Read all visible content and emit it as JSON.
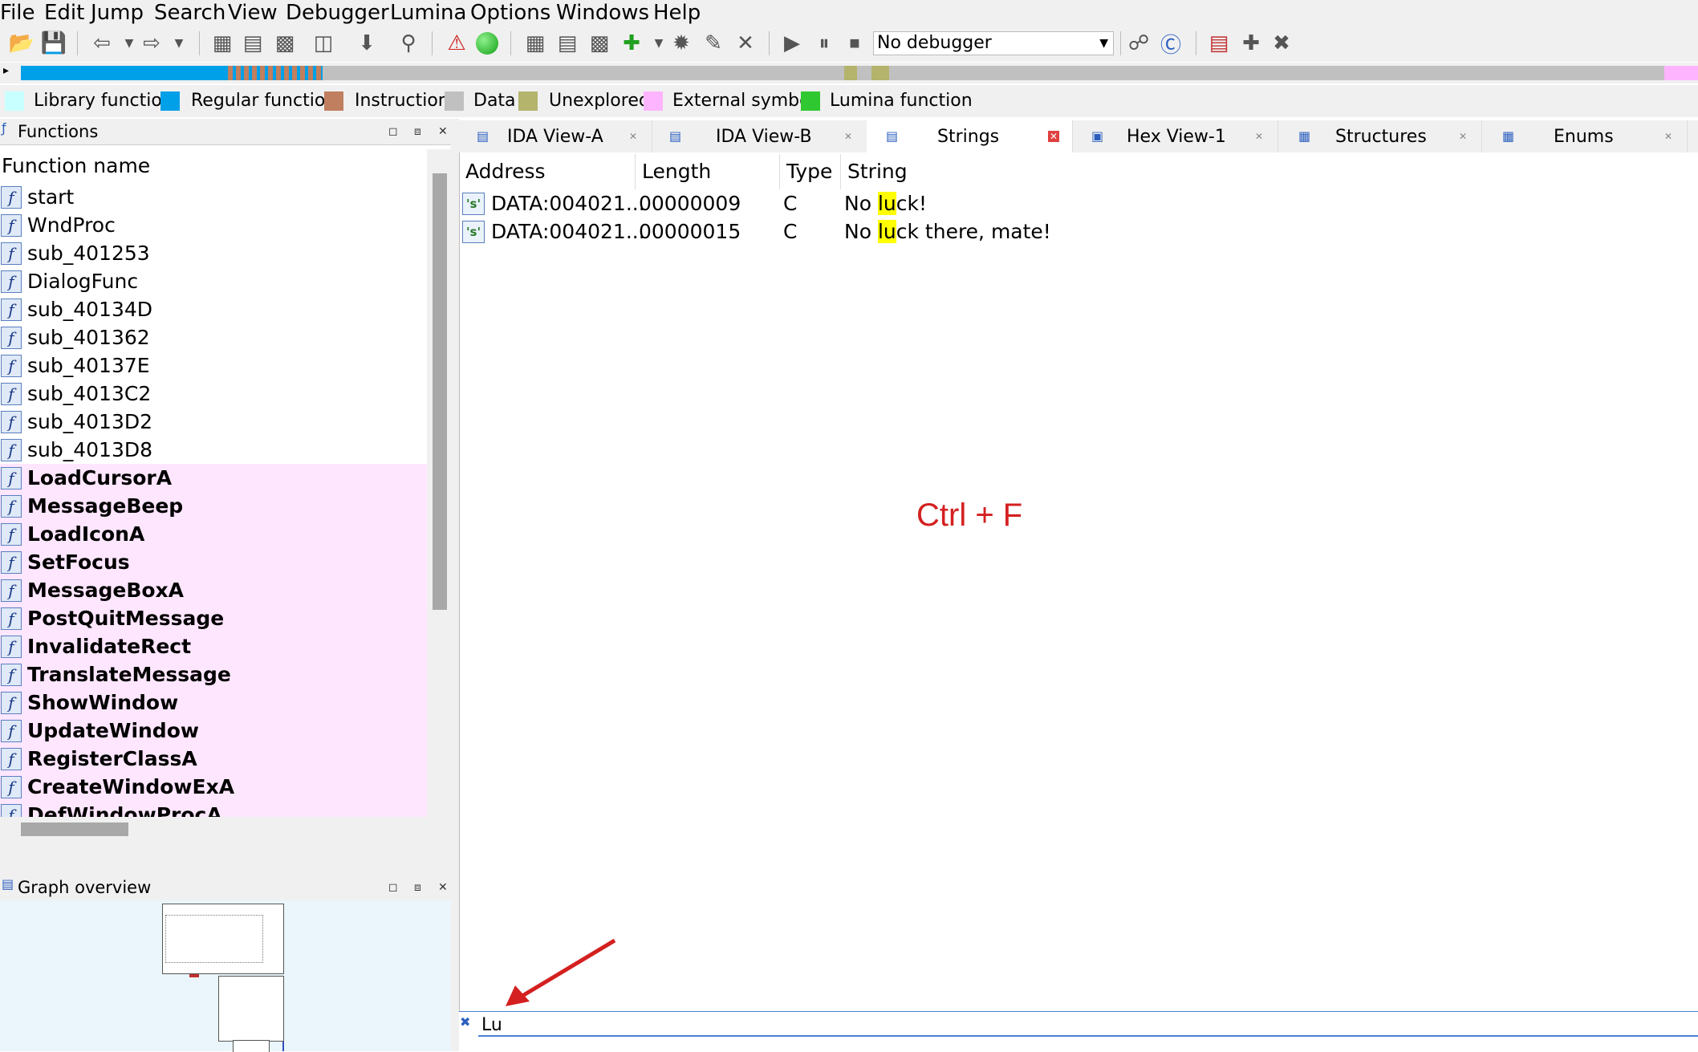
{
  "menu": [
    "File",
    "Edit",
    "Jump",
    "Search",
    "View",
    "Debugger",
    "Lumina",
    "Options",
    "Windows",
    "Help"
  ],
  "toolbar": {
    "debugger_select": "No debugger",
    "icons": [
      "open-icon",
      "save-icon",
      "back-icon",
      "forward-icon",
      "binary-search-icon",
      "text-search-icon",
      "imm-search-icon",
      "search-next-icon",
      "jump-down-icon",
      "find-icon",
      "warning-icon",
      "run-icon",
      "code-icon",
      "data-icon",
      "ascii-icon",
      "string-icon",
      "undefine-icon",
      "patch-icon",
      "cancel-icon",
      "debug-run-icon",
      "debug-pause-icon",
      "debug-stop-icon",
      "c-icon",
      "decompile-icon",
      "struct-icon",
      "add-icon",
      "remove-icon"
    ]
  },
  "legend": [
    {
      "label": "Library function",
      "color": "#c8ffff"
    },
    {
      "label": "Regular function",
      "color": "#00a0e8"
    },
    {
      "label": "Instruction",
      "color": "#c07f5e"
    },
    {
      "label": "Data",
      "color": "#c0c0c0"
    },
    {
      "label": "Unexplored",
      "color": "#b4b46c"
    },
    {
      "label": "External symbol",
      "color": "#ffb4ff"
    },
    {
      "label": "Lumina function",
      "color": "#30c830"
    }
  ],
  "functions_panel": {
    "title": "Functions",
    "column_header": "Function name",
    "items": [
      {
        "name": "start",
        "external": false
      },
      {
        "name": "WndProc",
        "external": false
      },
      {
        "name": "sub_401253",
        "external": false
      },
      {
        "name": "DialogFunc",
        "external": false
      },
      {
        "name": "sub_40134D",
        "external": false
      },
      {
        "name": "sub_401362",
        "external": false
      },
      {
        "name": "sub_40137E",
        "external": false
      },
      {
        "name": "sub_4013C2",
        "external": false
      },
      {
        "name": "sub_4013D2",
        "external": false
      },
      {
        "name": "sub_4013D8",
        "external": false
      },
      {
        "name": "LoadCursorA",
        "external": true
      },
      {
        "name": "MessageBeep",
        "external": true
      },
      {
        "name": "LoadIconA",
        "external": true
      },
      {
        "name": "SetFocus",
        "external": true
      },
      {
        "name": "MessageBoxA",
        "external": true
      },
      {
        "name": "PostQuitMessage",
        "external": true
      },
      {
        "name": "InvalidateRect",
        "external": true
      },
      {
        "name": "TranslateMessage",
        "external": true
      },
      {
        "name": "ShowWindow",
        "external": true
      },
      {
        "name": "UpdateWindow",
        "external": true
      },
      {
        "name": "RegisterClassA",
        "external": true
      },
      {
        "name": "CreateWindowExA",
        "external": true
      },
      {
        "name": "DefWindowProcA",
        "external": true
      }
    ]
  },
  "graph_panel": {
    "title": "Graph overview"
  },
  "tabs": [
    {
      "label": "IDA View-A",
      "active": false
    },
    {
      "label": "IDA View-B",
      "active": false
    },
    {
      "label": "Strings",
      "active": true
    },
    {
      "label": "Hex View-1",
      "active": false
    },
    {
      "label": "Structures",
      "active": false
    },
    {
      "label": "Enums",
      "active": false
    }
  ],
  "strings_view": {
    "columns": [
      "Address",
      "Length",
      "Type",
      "String"
    ],
    "rows": [
      {
        "address": "DATA:004021...",
        "length": "00000009",
        "type": "C",
        "string_pre": "No ",
        "string_match": "lu",
        "string_post": "ck!"
      },
      {
        "address": "DATA:004021...",
        "length": "00000015",
        "type": "C",
        "string_pre": "No ",
        "string_match": "lu",
        "string_post": "ck there, mate!"
      }
    ]
  },
  "annotation": "Ctrl + F",
  "filter": {
    "value": "Lu"
  }
}
